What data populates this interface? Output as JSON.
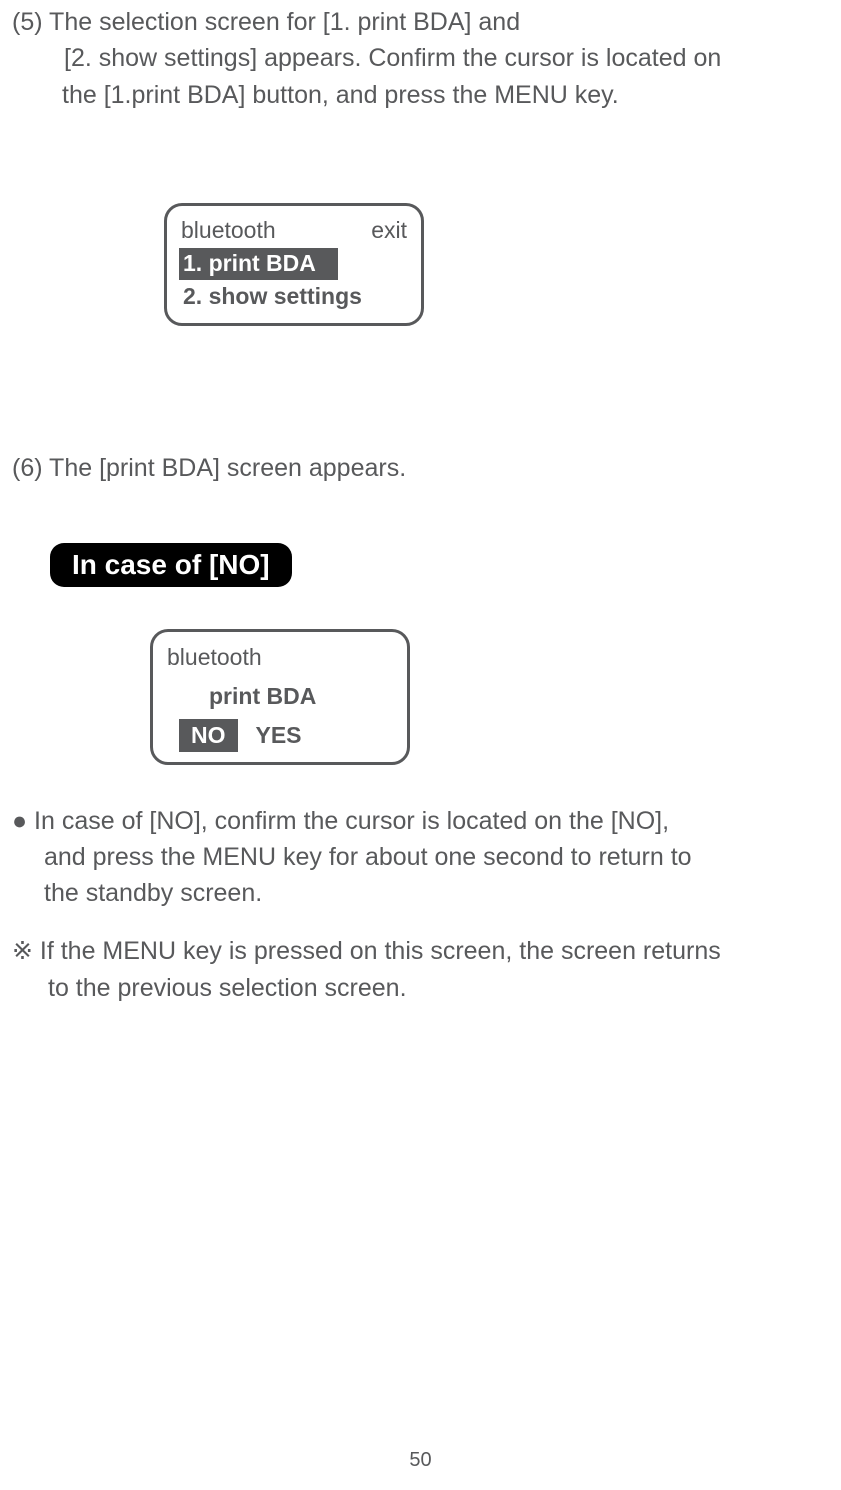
{
  "step5": {
    "line1": "(5)  The selection screen for [1. print BDA] and",
    "line2": "[2. show settings] appears.  Confirm the cursor is located on",
    "line3": "the [1.print BDA] button, and press the MENU key."
  },
  "screen1": {
    "title": "bluetooth",
    "exit": "exit",
    "item1": "1. print BDA",
    "item2": "2. show settings"
  },
  "step6": {
    "text": "(6) The [print BDA] screen appears."
  },
  "caseNoLabel": "In case of [NO]",
  "screen2": {
    "title": "bluetooth",
    "printBda": "print BDA",
    "no": "NO",
    "yes": "YES"
  },
  "bulletPara": {
    "line1": "● In case of [NO], confirm the cursor is located on the [NO],",
    "line2": "and press the MENU key for about one second to return to",
    "line3": "the standby screen."
  },
  "notePara": {
    "line1": "※ If the MENU key is pressed on this screen, the screen returns",
    "line2": "to the previous selection screen."
  },
  "pageNumber": "50"
}
